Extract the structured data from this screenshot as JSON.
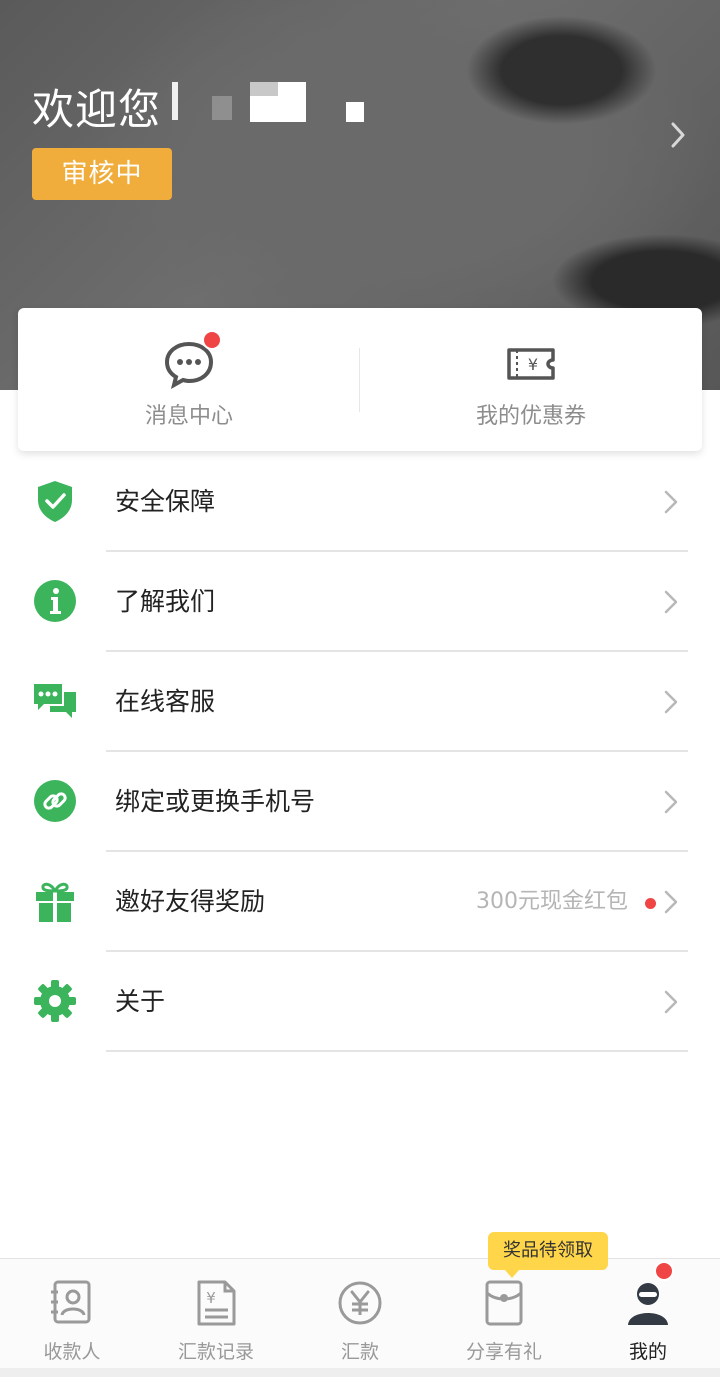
{
  "header": {
    "welcome": "欢迎您",
    "status": "审核中"
  },
  "quick": {
    "messages": "消息中心",
    "coupons": "我的优惠券"
  },
  "menu": {
    "items": [
      {
        "label": "安全保障",
        "icon": "shield-check-icon"
      },
      {
        "label": "了解我们",
        "icon": "info-icon"
      },
      {
        "label": "在线客服",
        "icon": "chat-bubbles-icon"
      },
      {
        "label": "绑定或更换手机号",
        "icon": "link-icon"
      },
      {
        "label": "邀好友得奖励",
        "icon": "gift-icon",
        "extra": "300元现金红包"
      },
      {
        "label": "关于",
        "icon": "gear-icon"
      }
    ]
  },
  "tabbar": {
    "tooltip": "奖品待领取",
    "tabs": [
      {
        "label": "收款人",
        "icon": "payee-icon"
      },
      {
        "label": "汇款记录",
        "icon": "remittance-record-icon"
      },
      {
        "label": "汇款",
        "icon": "yuan-circle-icon"
      },
      {
        "label": "分享有礼",
        "icon": "red-envelope-icon"
      },
      {
        "label": "我的",
        "icon": "user-avatar-icon",
        "active": true
      }
    ]
  },
  "colors": {
    "accent_green": "#3bb45c",
    "badge_orange": "#f0ad3b",
    "notify_red": "#f04545",
    "tooltip_yellow": "#ffd54a"
  }
}
